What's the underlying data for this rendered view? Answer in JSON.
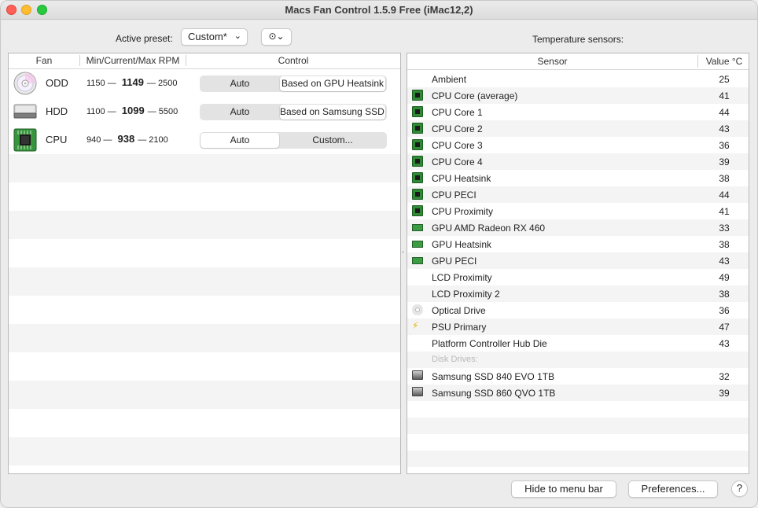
{
  "window": {
    "title": "Macs Fan Control 1.5.9 Free (iMac12,2)"
  },
  "preset": {
    "label": "Active preset:",
    "value": "Custom*",
    "more": "⋯"
  },
  "fan_table": {
    "headers": {
      "fan": "Fan",
      "rpm": "Min/Current/Max RPM",
      "control": "Control"
    },
    "fans": [
      {
        "name": "ODD",
        "icon": "optical-drive-icon",
        "min": "1150",
        "current": "1149",
        "max": "2500",
        "dash": "—",
        "auto": "Auto",
        "custom": "Based on GPU Heatsink",
        "selected": "custom"
      },
      {
        "name": "HDD",
        "icon": "hard-drive-icon",
        "min": "1100",
        "current": "1099",
        "max": "5500",
        "dash": "—",
        "auto": "Auto",
        "custom": "Based on Samsung SSD…",
        "selected": "custom"
      },
      {
        "name": "CPU",
        "icon": "cpu-chip-icon",
        "min": "940",
        "current": "938",
        "max": "2100",
        "dash": "—",
        "auto": "Auto",
        "custom": "Custom...",
        "selected": "auto"
      }
    ]
  },
  "sensors": {
    "title": "Temperature sensors:",
    "headers": {
      "sensor": "Sensor",
      "value": "Value °C"
    },
    "rows": [
      {
        "name": "Ambient",
        "value": "25",
        "icon": "none"
      },
      {
        "name": "CPU Core (average)",
        "value": "41",
        "icon": "cpu-chip-icon"
      },
      {
        "name": "CPU Core 1",
        "value": "44",
        "icon": "cpu-chip-icon"
      },
      {
        "name": "CPU Core 2",
        "value": "43",
        "icon": "cpu-chip-icon"
      },
      {
        "name": "CPU Core 3",
        "value": "36",
        "icon": "cpu-chip-icon"
      },
      {
        "name": "CPU Core 4",
        "value": "39",
        "icon": "cpu-chip-icon"
      },
      {
        "name": "CPU Heatsink",
        "value": "38",
        "icon": "cpu-chip-icon"
      },
      {
        "name": "CPU PECI",
        "value": "44",
        "icon": "cpu-chip-icon"
      },
      {
        "name": "CPU Proximity",
        "value": "41",
        "icon": "cpu-chip-icon"
      },
      {
        "name": "GPU AMD Radeon RX 460",
        "value": "33",
        "icon": "gpu-card-icon"
      },
      {
        "name": "GPU Heatsink",
        "value": "38",
        "icon": "gpu-card-icon"
      },
      {
        "name": "GPU PECI",
        "value": "43",
        "icon": "gpu-card-icon"
      },
      {
        "name": "LCD Proximity",
        "value": "49",
        "icon": "none"
      },
      {
        "name": "LCD Proximity 2",
        "value": "38",
        "icon": "none"
      },
      {
        "name": "Optical Drive",
        "value": "36",
        "icon": "optical-drive-icon"
      },
      {
        "name": "PSU Primary",
        "value": "47",
        "icon": "power-bolt-icon"
      },
      {
        "name": "Platform Controller Hub Die",
        "value": "43",
        "icon": "none"
      },
      {
        "name": "Disk Drives:",
        "value": "",
        "icon": "none",
        "group": true
      },
      {
        "name": "Samsung SSD 840 EVO 1TB",
        "value": "32",
        "icon": "hard-drive-icon"
      },
      {
        "name": "Samsung SSD 860 QVO 1TB",
        "value": "39",
        "icon": "hard-drive-icon"
      }
    ]
  },
  "buttons": {
    "hide": "Hide to menu bar",
    "prefs": "Preferences...",
    "help": "?"
  }
}
